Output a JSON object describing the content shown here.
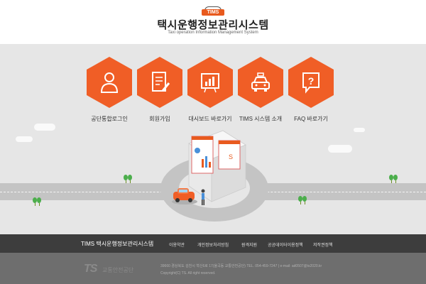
{
  "header": {
    "logo_text": "TIMS",
    "title": "택시운행정보관리시스템",
    "subtitle": "Taxi operation Information Management System"
  },
  "menu": {
    "items": [
      {
        "label": "공단통합로그인",
        "icon": "person-icon"
      },
      {
        "label": "회원가입",
        "icon": "document-pencil-icon"
      },
      {
        "label": "대시보드 바로가기",
        "icon": "chart-board-icon"
      },
      {
        "label": "TIMS 시스템 소개",
        "icon": "taxi-icon"
      },
      {
        "label": "FAQ 바로가기",
        "icon": "question-bubble-icon"
      }
    ]
  },
  "footer": {
    "brand": "TIMS 택시운행정보관리시스템",
    "links": [
      "이용약관",
      "개인정보처리방침",
      "원격지원",
      "공공데이터이용정책",
      "저작권정책"
    ],
    "org_logo": "TS",
    "org_name": "교통안전공단",
    "address": "39660 경상북도 김천시 혁신6로 17(율곡동 교통안전공단) TEL. 054-459-7247 | e-mail: ad0507@ts2020.kr",
    "copyright": "Copyright(C) TS. All right reserved."
  },
  "colors": {
    "accent": "#f05e26",
    "header_bg": "#ffffff",
    "scene_bg": "#e6e6e6",
    "footer_nav_bg": "#3d3d3d",
    "footer_bottom_bg": "#6e6e6e"
  }
}
